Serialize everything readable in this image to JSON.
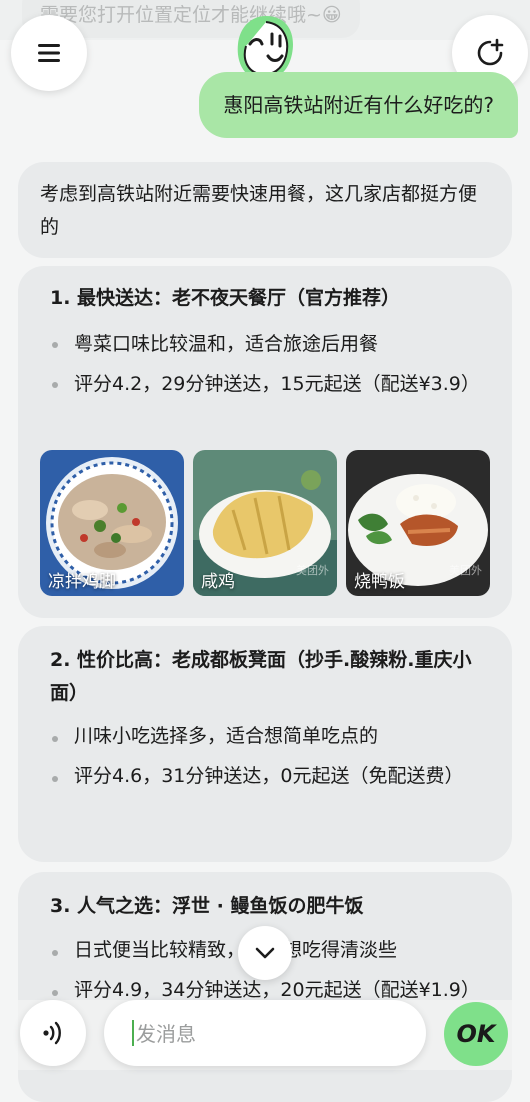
{
  "top_message": "需要您打开位置定位才能继续哦~😀",
  "header": {
    "menu_icon": "menu-icon",
    "mascot_icon": "mascot-icon",
    "new_chat_icon": "new-chat-icon"
  },
  "user_message": "惠阳高铁站附近有什么好吃的?",
  "intro": "考虑到高铁站附近需要快速用餐，这几家店都挺方便的",
  "restaurants": [
    {
      "title": "1. 最快送达：老不夜天餐厅（官方推荐）",
      "lines": [
        "粤菜口味比较温和，适合旅途后用餐",
        "评分4.2，29分钟送达，15元起送（配送¥3.9）"
      ],
      "dishes": [
        {
          "name": "凉拌鸡脚",
          "watermark": ""
        },
        {
          "name": "咸鸡",
          "watermark": "美团外"
        },
        {
          "name": "烧鸭饭",
          "watermark": "美团外"
        }
      ]
    },
    {
      "title": "2. 性价比高：老成都板凳面（抄手.酸辣粉.重庆小面）",
      "lines": [
        "川味小吃选择多，适合想简单吃点的",
        "评分4.6，31分钟送达，0元起送（免配送费）"
      ]
    },
    {
      "title": "3. 人气之选：浮世 · 鳗鱼饭の肥牛饭",
      "lines": [
        "日式便当比较精致，适合想吃得清淡些",
        "评分4.9，34分钟送达，20元起送（配送¥1.9）"
      ]
    }
  ],
  "scroll_down_icon": "chevron-down-icon",
  "input": {
    "placeholder": "发消息",
    "value": ""
  },
  "voice_icon": "voice-icon",
  "ok_label": "OK",
  "colors": {
    "user_bubble": "#a9e6a6",
    "accent": "#7fe08a",
    "card": "#e8eaeb"
  }
}
